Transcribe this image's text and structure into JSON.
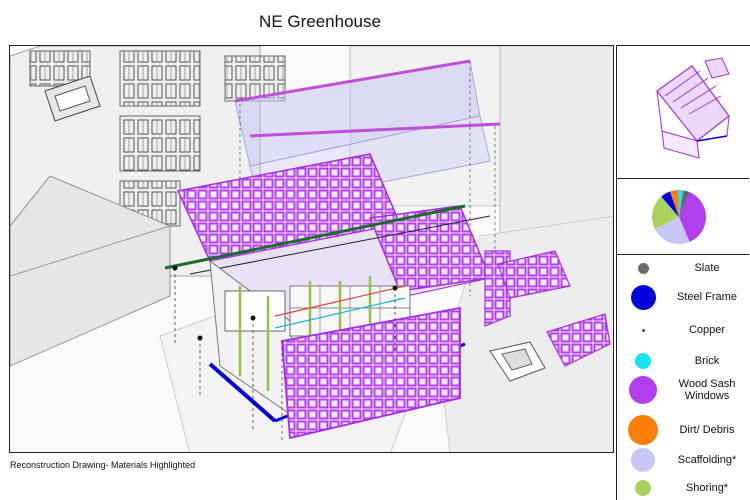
{
  "title": "NE Greenhouse",
  "caption": "Reconstruction Drawing- Materials Highlighted",
  "legend": [
    {
      "label": "Slate",
      "color": "#6b6b6b",
      "icon": "slate-swatch"
    },
    {
      "label": "Steel Frame",
      "color": "#0000dd",
      "icon": "steel-frame-swatch"
    },
    {
      "label": "Copper",
      "color": "#1f6b2a",
      "icon": "copper-swatch"
    },
    {
      "label": "Brick",
      "color": "#18e6ef",
      "icon": "brick-swatch"
    },
    {
      "label": "Wood Sash Windows",
      "color": "#b23ef0",
      "icon": "wood-sash-windows-swatch"
    },
    {
      "label": "Dirt/ Debris",
      "color": "#fa7f0a",
      "icon": "dirt-debris-swatch"
    },
    {
      "label": "Scaffolding*",
      "color": "#c9c7f5",
      "icon": "scaffolding-swatch"
    },
    {
      "label": "Shoring*",
      "color": "#a9d35c",
      "icon": "shoring-swatch"
    }
  ],
  "chart_data": {
    "type": "pie",
    "labels": [
      "Wood Sash Windows",
      "Scaffolding*",
      "Shoring*",
      "Steel Frame",
      "Dirt/ Debris",
      "Brick",
      "Slate",
      "Copper"
    ],
    "values": [
      38,
      24,
      21,
      6,
      5,
      3,
      2,
      1
    ],
    "colors": [
      "#b23ef0",
      "#c9c7f5",
      "#a9d35c",
      "#0000dd",
      "#fa7f0a",
      "#18e6ef",
      "#6b6b6b",
      "#1f6b2a"
    ]
  }
}
